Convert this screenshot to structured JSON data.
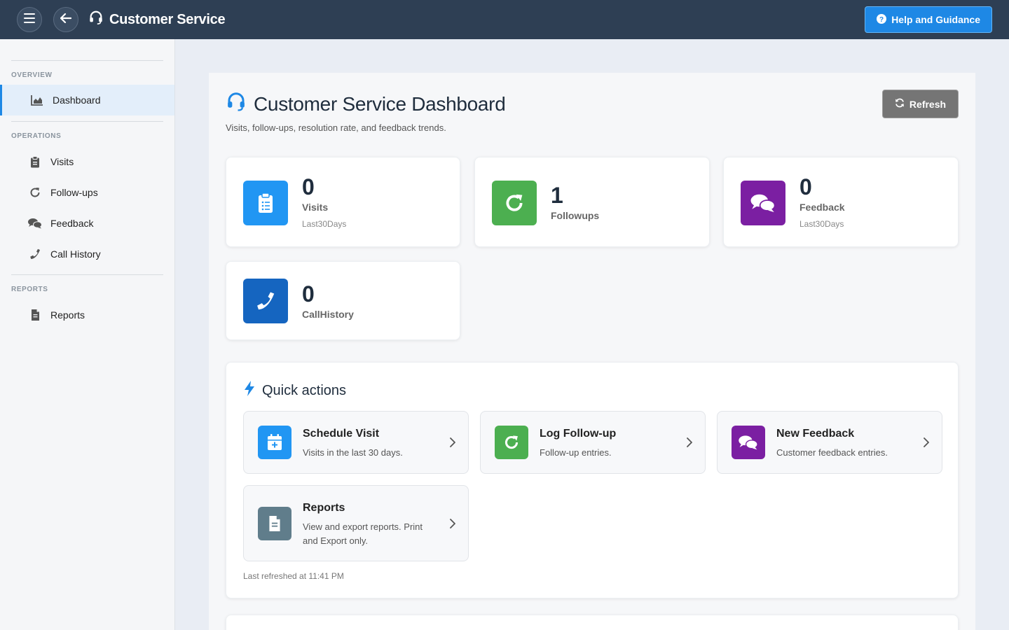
{
  "header": {
    "title": "Customer Service",
    "help_label": "Help and Guidance"
  },
  "sidebar": {
    "sections": [
      {
        "label": "OVERVIEW",
        "items": [
          {
            "label": "Dashboard",
            "icon": "chart-area-icon",
            "active": true
          }
        ]
      },
      {
        "label": "OPERATIONS",
        "items": [
          {
            "label": "Visits",
            "icon": "clipboard-icon"
          },
          {
            "label": "Follow-ups",
            "icon": "redo-icon"
          },
          {
            "label": "Feedback",
            "icon": "comments-icon"
          },
          {
            "label": "Call History",
            "icon": "phone-icon"
          }
        ]
      },
      {
        "label": "REPORTS",
        "items": [
          {
            "label": "Reports",
            "icon": "file-icon"
          }
        ]
      }
    ]
  },
  "main": {
    "title": "Customer Service Dashboard",
    "subtitle": "Visits, follow-ups, resolution rate, and feedback trends.",
    "refresh_label": "Refresh",
    "stats": [
      {
        "value": "0",
        "label": "Visits",
        "sub": "Last30Days",
        "color": "#2196f3",
        "icon": "clipboard-list-icon"
      },
      {
        "value": "1",
        "label": "Followups",
        "sub": "",
        "color": "#4caf50",
        "icon": "redo-icon"
      },
      {
        "value": "0",
        "label": "Feedback",
        "sub": "Last30Days",
        "color": "#7b1fa2",
        "icon": "comments-icon"
      },
      {
        "value": "0",
        "label": "CallHistory",
        "sub": "",
        "color": "#1565c0",
        "icon": "phone-icon"
      }
    ],
    "quick_actions": {
      "title": "Quick actions",
      "items": [
        {
          "title": "Schedule Visit",
          "desc": "Visits in the last 30 days.",
          "color": "#2196f3",
          "icon": "calendar-plus-icon"
        },
        {
          "title": "Log Follow-up",
          "desc": "Follow-up entries.",
          "color": "#4caf50",
          "icon": "redo-icon"
        },
        {
          "title": "New Feedback",
          "desc": "Customer feedback entries.",
          "color": "#7b1fa2",
          "icon": "comments-icon"
        },
        {
          "title": "Reports",
          "desc": "View and export reports. Print and Export only.",
          "color": "#607d8b",
          "icon": "file-icon"
        }
      ],
      "last_refreshed": "Last refreshed at 11:41 PM"
    }
  }
}
